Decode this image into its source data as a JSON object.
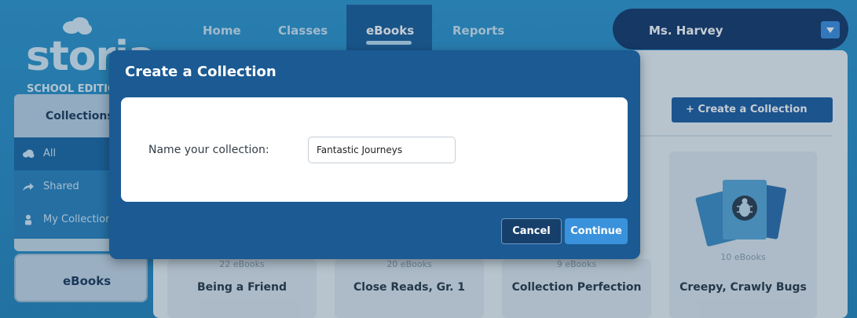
{
  "logo": {
    "word": "storia",
    "edition": "SCHOOL EDITION"
  },
  "nav": {
    "items": [
      {
        "label": "Home"
      },
      {
        "label": "Classes"
      },
      {
        "label": "eBooks"
      },
      {
        "label": "Reports"
      }
    ],
    "active": "eBooks"
  },
  "user": {
    "name": "Ms. Harvey"
  },
  "sidebar": {
    "header": "Collections",
    "items": [
      {
        "label": "All",
        "icon": "cloud-icon"
      },
      {
        "label": "Shared",
        "icon": "share-arrow-icon"
      },
      {
        "label": "My Collections",
        "icon": "person-icon"
      }
    ],
    "ebooks_label": "eBooks"
  },
  "main": {
    "create_button": "+ Create a Collection",
    "cards": [
      {
        "title": "Being a Friend",
        "count": "22 eBooks"
      },
      {
        "title": "Close Reads, Gr. 1",
        "count": "20 eBooks"
      },
      {
        "title": "Collection Perfection",
        "count": "9 eBooks"
      },
      {
        "title": "Creepy, Crawly Bugs",
        "count": "10 eBooks"
      }
    ]
  },
  "modal": {
    "title": "Create a Collection",
    "name_label": "Name your collection:",
    "name_value": "Fantastic Journeys",
    "cancel_label": "Cancel",
    "continue_label": "Continue"
  },
  "colors": {
    "brand_blue": "#2a90c8",
    "modal_blue": "#1b5a93",
    "accent_button": "#3a92dc",
    "nav_dark": "#173a6d"
  }
}
